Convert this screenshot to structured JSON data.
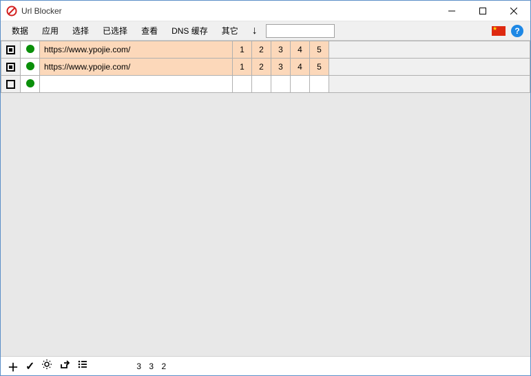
{
  "window": {
    "title": "Url Blocker"
  },
  "menu": {
    "items": [
      "数据",
      "应用",
      "选择",
      "已选择",
      "查看",
      "DNS 缓存",
      "其它"
    ]
  },
  "search": {
    "placeholder": ""
  },
  "rows": [
    {
      "checked": true,
      "status": "green",
      "url": "https://www.ypojie.com/",
      "nums": [
        "1",
        "2",
        "3",
        "4",
        "5"
      ]
    },
    {
      "checked": true,
      "status": "green",
      "url": "https://www.ypojie.com/",
      "nums": [
        "1",
        "2",
        "3",
        "4",
        "5"
      ]
    },
    {
      "checked": false,
      "status": "green",
      "url": "",
      "nums": [
        "",
        "",
        "",
        "",
        ""
      ]
    }
  ],
  "status": {
    "counts": "3  3  2"
  }
}
